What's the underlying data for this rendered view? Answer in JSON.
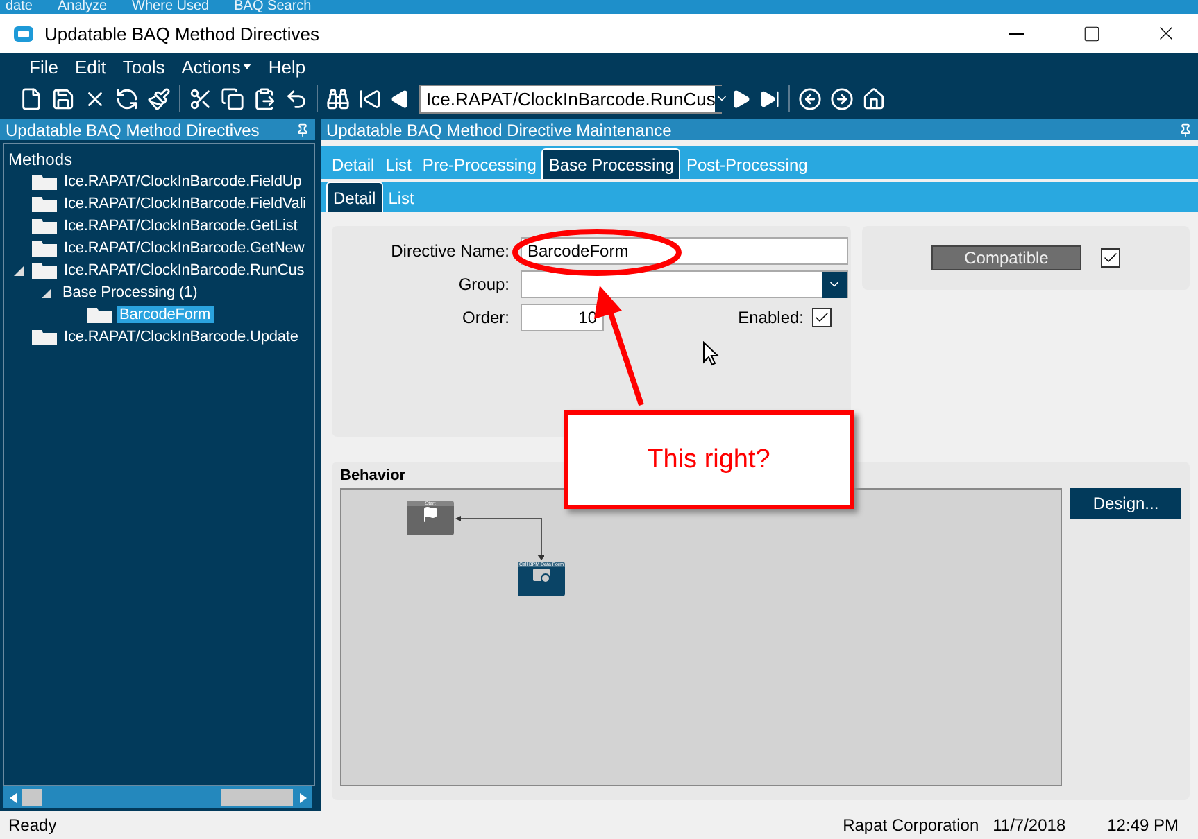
{
  "background_menu": [
    "date",
    "Analyze",
    "Where Used",
    "BAQ Search"
  ],
  "window": {
    "title": "Updatable BAQ Method Directives"
  },
  "menu": [
    {
      "label": "File",
      "has_arrow": false
    },
    {
      "label": "Edit",
      "has_arrow": false
    },
    {
      "label": "Tools",
      "has_arrow": false
    },
    {
      "label": "Actions",
      "has_arrow": true
    },
    {
      "label": "Help",
      "has_arrow": false
    }
  ],
  "toolbar": {
    "record_combo": "Ice.RAPAT/ClockInBarcode.RunCus"
  },
  "tree_panel": {
    "title": "Updatable BAQ Method Directives",
    "root": "Methods",
    "items": [
      {
        "label": "Ice.RAPAT/ClockInBarcode.FieldUp",
        "selected": false,
        "expanded": false
      },
      {
        "label": "Ice.RAPAT/ClockInBarcode.FieldVali",
        "selected": false,
        "expanded": false
      },
      {
        "label": "Ice.RAPAT/ClockInBarcode.GetList",
        "selected": false,
        "expanded": false
      },
      {
        "label": "Ice.RAPAT/ClockInBarcode.GetNew",
        "selected": false,
        "expanded": false
      },
      {
        "label": "Ice.RAPAT/ClockInBarcode.RunCus",
        "selected": false,
        "expanded": true,
        "children": [
          {
            "label": "Base Processing (1)",
            "kind": "group",
            "selected": false,
            "expanded": true,
            "children": [
              {
                "label": "BarcodeForm",
                "selected": true,
                "expanded": false
              }
            ]
          }
        ]
      },
      {
        "label": "Ice.RAPAT/ClockInBarcode.Update",
        "selected": false,
        "expanded": false
      }
    ]
  },
  "main_panel": {
    "title": "Updatable BAQ Method Directive Maintenance",
    "tabs": [
      {
        "label": "Detail",
        "selected": false
      },
      {
        "label": "List",
        "selected": false
      },
      {
        "label": "Pre-Processing",
        "selected": false
      },
      {
        "label": "Base Processing",
        "selected": true
      },
      {
        "label": "Post-Processing",
        "selected": false
      }
    ],
    "subtabs": [
      {
        "label": "Detail",
        "selected": true
      },
      {
        "label": "List",
        "selected": false
      }
    ],
    "form": {
      "directive_name_label": "Directive Name:",
      "directive_name": "BarcodeForm",
      "group_label": "Group:",
      "order_label": "Order:",
      "order": "10",
      "enabled_label": "Enabled:",
      "enabled": true
    },
    "compatible": {
      "label": "Compatible",
      "checked": true
    },
    "behavior": {
      "title": "Behavior",
      "design_button": "Design...",
      "nodes": [
        {
          "title": "Start",
          "kind": "start"
        },
        {
          "title": "Call BPM Data Form",
          "kind": "form"
        }
      ]
    }
  },
  "annotation": {
    "text": "This right?"
  },
  "status_bar": {
    "status": "Ready",
    "company": "Rapat Corporation",
    "date": "11/7/2018",
    "time": "12:49 PM"
  }
}
